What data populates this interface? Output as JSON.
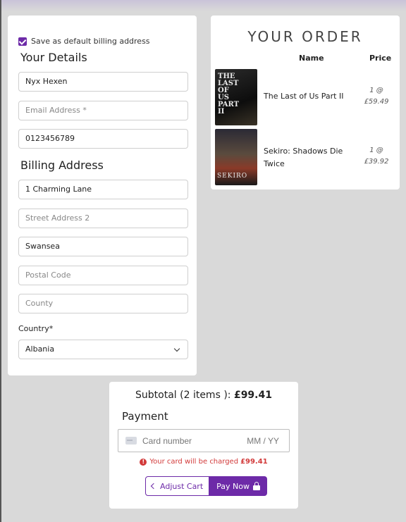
{
  "details": {
    "save_default_label": "Save as default billing address",
    "save_default_checked": true,
    "your_details_title": "Your Details",
    "full_name": {
      "value": "Nyx Hexen",
      "placeholder": ""
    },
    "email": {
      "value": "",
      "placeholder": "Email Address *"
    },
    "phone": {
      "value": "0123456789",
      "placeholder": ""
    },
    "billing_title": "Billing Address",
    "street1": {
      "value": "1 Charming Lane",
      "placeholder": ""
    },
    "street2": {
      "value": "",
      "placeholder": "Street Address 2"
    },
    "town": {
      "value": "Swansea",
      "placeholder": ""
    },
    "postcode": {
      "value": "",
      "placeholder": "Postal Code"
    },
    "county": {
      "value": "",
      "placeholder": "County"
    },
    "country_label": "Country*",
    "country_selected": "Albania"
  },
  "order": {
    "title": "YOUR ORDER",
    "col_name": "Name",
    "col_price": "Price",
    "items": [
      {
        "name": "The Last of Us Part II",
        "qty": "1 @",
        "price": "£59.49",
        "cover_text": "THE LAST OF US PART II"
      },
      {
        "name": "Sekiro: Shadows Die Twice",
        "qty": "1 @",
        "price": "£39.92",
        "cover_text": "SEKIRO"
      }
    ]
  },
  "summary": {
    "subtotal_label": "Subtotal (2 items ):",
    "subtotal_value": "£99.41",
    "payment_title": "Payment",
    "card_placeholder": "Card number",
    "expiry_placeholder": "MM / YY",
    "charge_text": "Your card will be charged",
    "charge_amount": "£99.41",
    "adjust_label": "Adjust Cart",
    "pay_label": "Pay Now"
  },
  "colors": {
    "accent": "#6d2aa8",
    "warning": "#d23a3a",
    "background": "#d9d9d9"
  }
}
